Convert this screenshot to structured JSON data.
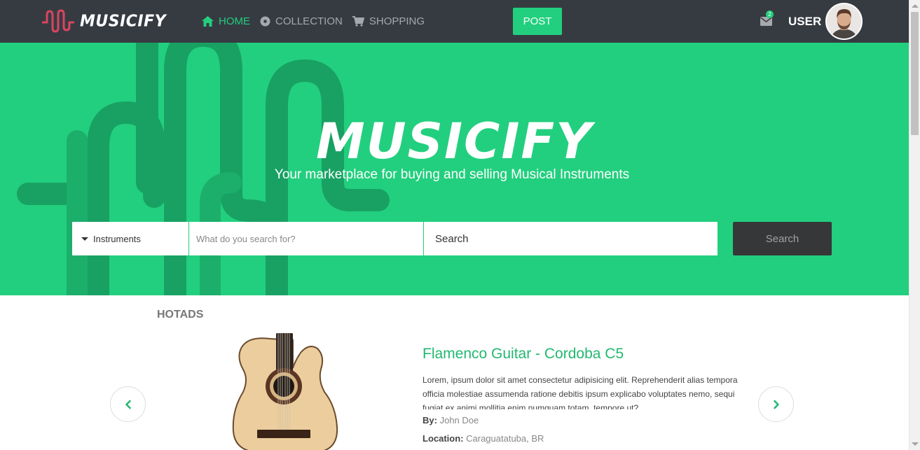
{
  "app": {
    "brand": "MUSICIFY"
  },
  "nav": {
    "items": [
      {
        "label": "HOME",
        "icon": "home-icon",
        "active": true
      },
      {
        "label": "COLLECTION",
        "icon": "disc-icon",
        "active": false
      },
      {
        "label": "SHOPPING",
        "icon": "cart-icon",
        "active": false
      }
    ],
    "post_label": "POST",
    "mail_count": "2",
    "user_label": "USER"
  },
  "hero": {
    "title": "MUSICIFY",
    "subtitle": "Your marketplace for buying and selling Musical Instruments",
    "category_selected": "Instruments",
    "query_placeholder": "What do you search for?",
    "location_placeholder": "Search",
    "search_button": "Search"
  },
  "hotads": {
    "heading": "HOTADS",
    "ad": {
      "title": "Flamenco Guitar - Cordoba C5",
      "description": "Lorem, ipsum dolor sit amet consectetur adipisicing elit. Reprehenderit alias tempora officia molestiae assumenda ratione debitis ipsum explicabo voluptates nemo, sequi fugiat ex animi mollitia enim numquam totam, tempore ut?",
      "by_label": "By:",
      "by_value": "John Doe",
      "location_label": "Location:",
      "location_value": "Caraguatatuba, BR"
    }
  },
  "colors": {
    "accent": "#22cf7e",
    "navbar": "#363b42",
    "search_button": "#363738"
  }
}
